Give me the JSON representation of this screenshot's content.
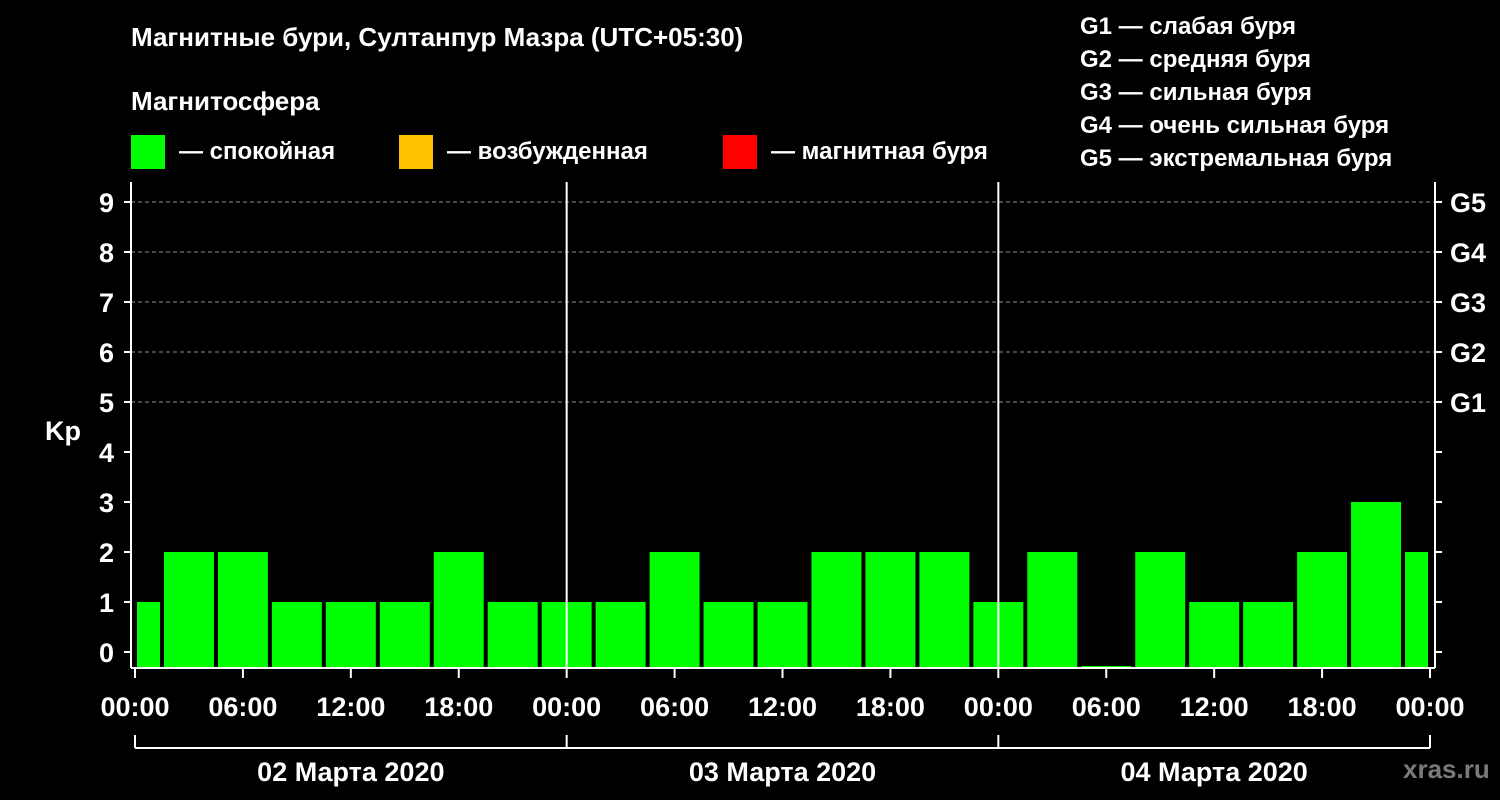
{
  "header": {
    "title": "Магнитные бури, Султанпур Мазра (UTC+05:30)",
    "magnetosphere_title": "Магнитосфера"
  },
  "legend": {
    "quiet": {
      "label": "— спокойная",
      "color": "#00ff00"
    },
    "active": {
      "label": "— возбужденная",
      "color": "#ffc000"
    },
    "storm": {
      "label": "— магнитная буря",
      "color": "#ff0000"
    }
  },
  "g_legend": [
    "G1 — слабая буря",
    "G2 — средняя буря",
    "G3 — сильная буря",
    "G4 — очень сильная буря",
    "G5 — экстремальная буря"
  ],
  "watermark": "xras.ru",
  "chart_data": {
    "type": "bar",
    "ylabel": "Kp",
    "ylim": [
      0,
      9
    ],
    "yticks": [
      "0",
      "1",
      "2",
      "3",
      "4",
      "5",
      "6",
      "7",
      "8",
      "9"
    ],
    "right_ticks": [
      {
        "value": 5,
        "label": "G1"
      },
      {
        "value": 6,
        "label": "G2"
      },
      {
        "value": 7,
        "label": "G3"
      },
      {
        "value": 8,
        "label": "G4"
      },
      {
        "value": 9,
        "label": "G5"
      }
    ],
    "xlim_hours": [
      0,
      72
    ],
    "xticks": [
      {
        "hour": 0,
        "label": "00:00"
      },
      {
        "hour": 6,
        "label": "06:00"
      },
      {
        "hour": 12,
        "label": "12:00"
      },
      {
        "hour": 18,
        "label": "18:00"
      },
      {
        "hour": 24,
        "label": "00:00"
      },
      {
        "hour": 30,
        "label": "06:00"
      },
      {
        "hour": 36,
        "label": "12:00"
      },
      {
        "hour": 42,
        "label": "18:00"
      },
      {
        "hour": 48,
        "label": "00:00"
      },
      {
        "hour": 54,
        "label": "06:00"
      },
      {
        "hour": 60,
        "label": "12:00"
      },
      {
        "hour": 66,
        "label": "18:00"
      },
      {
        "hour": 72,
        "label": "00:00"
      }
    ],
    "days": [
      {
        "label": "02 Марта 2020",
        "start_hour": 0,
        "end_hour": 24
      },
      {
        "label": "03 Марта 2020",
        "start_hour": 24,
        "end_hour": 48
      },
      {
        "label": "04 Марта 2020",
        "start_hour": 48,
        "end_hour": 72
      }
    ],
    "grid": true,
    "series": [
      {
        "values": [
          {
            "start_hour": 0,
            "end_hour": 1.5,
            "kp": 1
          },
          {
            "start_hour": 1.5,
            "end_hour": 4.5,
            "kp": 2
          },
          {
            "start_hour": 4.5,
            "end_hour": 7.5,
            "kp": 2
          },
          {
            "start_hour": 7.5,
            "end_hour": 10.5,
            "kp": 1
          },
          {
            "start_hour": 10.5,
            "end_hour": 13.5,
            "kp": 1
          },
          {
            "start_hour": 13.5,
            "end_hour": 16.5,
            "kp": 1
          },
          {
            "start_hour": 16.5,
            "end_hour": 19.5,
            "kp": 2
          },
          {
            "start_hour": 19.5,
            "end_hour": 22.5,
            "kp": 1
          },
          {
            "start_hour": 22.5,
            "end_hour": 25.5,
            "kp": 1
          },
          {
            "start_hour": 25.5,
            "end_hour": 28.5,
            "kp": 1
          },
          {
            "start_hour": 28.5,
            "end_hour": 31.5,
            "kp": 2
          },
          {
            "start_hour": 31.5,
            "end_hour": 34.5,
            "kp": 1
          },
          {
            "start_hour": 34.5,
            "end_hour": 37.5,
            "kp": 1
          },
          {
            "start_hour": 37.5,
            "end_hour": 40.5,
            "kp": 2
          },
          {
            "start_hour": 40.5,
            "end_hour": 43.5,
            "kp": 2
          },
          {
            "start_hour": 43.5,
            "end_hour": 46.5,
            "kp": 2
          },
          {
            "start_hour": 46.5,
            "end_hour": 49.5,
            "kp": 1
          },
          {
            "start_hour": 49.5,
            "end_hour": 52.5,
            "kp": 2
          },
          {
            "start_hour": 52.5,
            "end_hour": 55.5,
            "kp": 0
          },
          {
            "start_hour": 55.5,
            "end_hour": 58.5,
            "kp": 2
          },
          {
            "start_hour": 58.5,
            "end_hour": 61.5,
            "kp": 1
          },
          {
            "start_hour": 61.5,
            "end_hour": 64.5,
            "kp": 1
          },
          {
            "start_hour": 64.5,
            "end_hour": 67.5,
            "kp": 2
          },
          {
            "start_hour": 67.5,
            "end_hour": 70.5,
            "kp": 3
          },
          {
            "start_hour": 70.5,
            "end_hour": 72,
            "kp": 2
          }
        ]
      }
    ]
  }
}
